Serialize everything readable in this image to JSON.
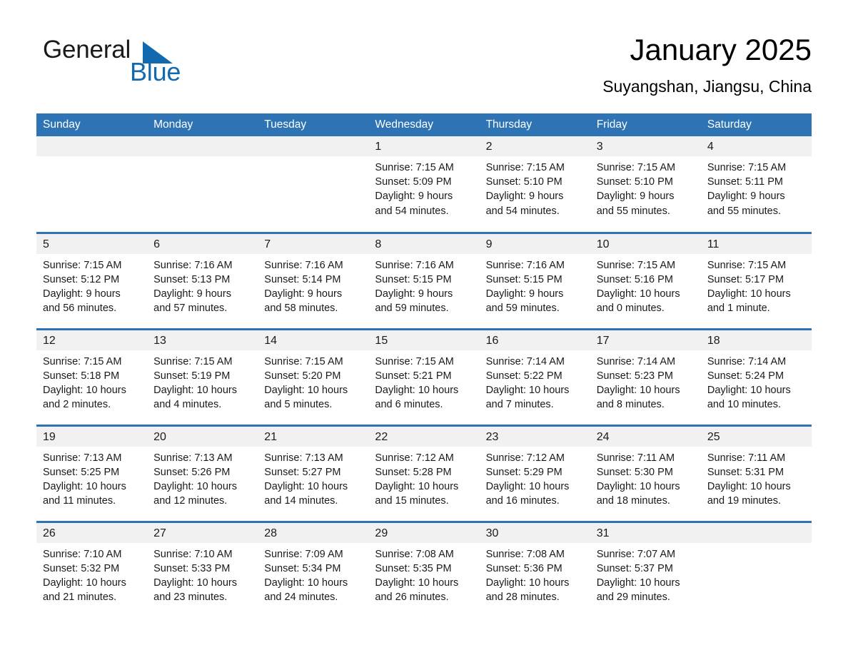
{
  "brand": {
    "name_part1": "General",
    "name_part2": "Blue",
    "accent_color": "#1369b0",
    "triangle_icon": "triangle-icon"
  },
  "header": {
    "month_title": "January 2025",
    "location": "Suyangshan, Jiangsu, China"
  },
  "calendar": {
    "header_color": "#2e74b5",
    "daynum_strip_color": "#f1f1f1",
    "weekday_headers": [
      "Sunday",
      "Monday",
      "Tuesday",
      "Wednesday",
      "Thursday",
      "Friday",
      "Saturday"
    ],
    "weeks": [
      [
        {
          "day": "",
          "sunrise": "",
          "sunset": "",
          "daylight": "",
          "daylight2": ""
        },
        {
          "day": "",
          "sunrise": "",
          "sunset": "",
          "daylight": "",
          "daylight2": ""
        },
        {
          "day": "",
          "sunrise": "",
          "sunset": "",
          "daylight": "",
          "daylight2": ""
        },
        {
          "day": "1",
          "sunrise": "Sunrise: 7:15 AM",
          "sunset": "Sunset: 5:09 PM",
          "daylight": "Daylight: 9 hours",
          "daylight2": "and 54 minutes."
        },
        {
          "day": "2",
          "sunrise": "Sunrise: 7:15 AM",
          "sunset": "Sunset: 5:10 PM",
          "daylight": "Daylight: 9 hours",
          "daylight2": "and 54 minutes."
        },
        {
          "day": "3",
          "sunrise": "Sunrise: 7:15 AM",
          "sunset": "Sunset: 5:10 PM",
          "daylight": "Daylight: 9 hours",
          "daylight2": "and 55 minutes."
        },
        {
          "day": "4",
          "sunrise": "Sunrise: 7:15 AM",
          "sunset": "Sunset: 5:11 PM",
          "daylight": "Daylight: 9 hours",
          "daylight2": "and 55 minutes."
        }
      ],
      [
        {
          "day": "5",
          "sunrise": "Sunrise: 7:15 AM",
          "sunset": "Sunset: 5:12 PM",
          "daylight": "Daylight: 9 hours",
          "daylight2": "and 56 minutes."
        },
        {
          "day": "6",
          "sunrise": "Sunrise: 7:16 AM",
          "sunset": "Sunset: 5:13 PM",
          "daylight": "Daylight: 9 hours",
          "daylight2": "and 57 minutes."
        },
        {
          "day": "7",
          "sunrise": "Sunrise: 7:16 AM",
          "sunset": "Sunset: 5:14 PM",
          "daylight": "Daylight: 9 hours",
          "daylight2": "and 58 minutes."
        },
        {
          "day": "8",
          "sunrise": "Sunrise: 7:16 AM",
          "sunset": "Sunset: 5:15 PM",
          "daylight": "Daylight: 9 hours",
          "daylight2": "and 59 minutes."
        },
        {
          "day": "9",
          "sunrise": "Sunrise: 7:16 AM",
          "sunset": "Sunset: 5:15 PM",
          "daylight": "Daylight: 9 hours",
          "daylight2": "and 59 minutes."
        },
        {
          "day": "10",
          "sunrise": "Sunrise: 7:15 AM",
          "sunset": "Sunset: 5:16 PM",
          "daylight": "Daylight: 10 hours",
          "daylight2": "and 0 minutes."
        },
        {
          "day": "11",
          "sunrise": "Sunrise: 7:15 AM",
          "sunset": "Sunset: 5:17 PM",
          "daylight": "Daylight: 10 hours",
          "daylight2": "and 1 minute."
        }
      ],
      [
        {
          "day": "12",
          "sunrise": "Sunrise: 7:15 AM",
          "sunset": "Sunset: 5:18 PM",
          "daylight": "Daylight: 10 hours",
          "daylight2": "and 2 minutes."
        },
        {
          "day": "13",
          "sunrise": "Sunrise: 7:15 AM",
          "sunset": "Sunset: 5:19 PM",
          "daylight": "Daylight: 10 hours",
          "daylight2": "and 4 minutes."
        },
        {
          "day": "14",
          "sunrise": "Sunrise: 7:15 AM",
          "sunset": "Sunset: 5:20 PM",
          "daylight": "Daylight: 10 hours",
          "daylight2": "and 5 minutes."
        },
        {
          "day": "15",
          "sunrise": "Sunrise: 7:15 AM",
          "sunset": "Sunset: 5:21 PM",
          "daylight": "Daylight: 10 hours",
          "daylight2": "and 6 minutes."
        },
        {
          "day": "16",
          "sunrise": "Sunrise: 7:14 AM",
          "sunset": "Sunset: 5:22 PM",
          "daylight": "Daylight: 10 hours",
          "daylight2": "and 7 minutes."
        },
        {
          "day": "17",
          "sunrise": "Sunrise: 7:14 AM",
          "sunset": "Sunset: 5:23 PM",
          "daylight": "Daylight: 10 hours",
          "daylight2": "and 8 minutes."
        },
        {
          "day": "18",
          "sunrise": "Sunrise: 7:14 AM",
          "sunset": "Sunset: 5:24 PM",
          "daylight": "Daylight: 10 hours",
          "daylight2": "and 10 minutes."
        }
      ],
      [
        {
          "day": "19",
          "sunrise": "Sunrise: 7:13 AM",
          "sunset": "Sunset: 5:25 PM",
          "daylight": "Daylight: 10 hours",
          "daylight2": "and 11 minutes."
        },
        {
          "day": "20",
          "sunrise": "Sunrise: 7:13 AM",
          "sunset": "Sunset: 5:26 PM",
          "daylight": "Daylight: 10 hours",
          "daylight2": "and 12 minutes."
        },
        {
          "day": "21",
          "sunrise": "Sunrise: 7:13 AM",
          "sunset": "Sunset: 5:27 PM",
          "daylight": "Daylight: 10 hours",
          "daylight2": "and 14 minutes."
        },
        {
          "day": "22",
          "sunrise": "Sunrise: 7:12 AM",
          "sunset": "Sunset: 5:28 PM",
          "daylight": "Daylight: 10 hours",
          "daylight2": "and 15 minutes."
        },
        {
          "day": "23",
          "sunrise": "Sunrise: 7:12 AM",
          "sunset": "Sunset: 5:29 PM",
          "daylight": "Daylight: 10 hours",
          "daylight2": "and 16 minutes."
        },
        {
          "day": "24",
          "sunrise": "Sunrise: 7:11 AM",
          "sunset": "Sunset: 5:30 PM",
          "daylight": "Daylight: 10 hours",
          "daylight2": "and 18 minutes."
        },
        {
          "day": "25",
          "sunrise": "Sunrise: 7:11 AM",
          "sunset": "Sunset: 5:31 PM",
          "daylight": "Daylight: 10 hours",
          "daylight2": "and 19 minutes."
        }
      ],
      [
        {
          "day": "26",
          "sunrise": "Sunrise: 7:10 AM",
          "sunset": "Sunset: 5:32 PM",
          "daylight": "Daylight: 10 hours",
          "daylight2": "and 21 minutes."
        },
        {
          "day": "27",
          "sunrise": "Sunrise: 7:10 AM",
          "sunset": "Sunset: 5:33 PM",
          "daylight": "Daylight: 10 hours",
          "daylight2": "and 23 minutes."
        },
        {
          "day": "28",
          "sunrise": "Sunrise: 7:09 AM",
          "sunset": "Sunset: 5:34 PM",
          "daylight": "Daylight: 10 hours",
          "daylight2": "and 24 minutes."
        },
        {
          "day": "29",
          "sunrise": "Sunrise: 7:08 AM",
          "sunset": "Sunset: 5:35 PM",
          "daylight": "Daylight: 10 hours",
          "daylight2": "and 26 minutes."
        },
        {
          "day": "30",
          "sunrise": "Sunrise: 7:08 AM",
          "sunset": "Sunset: 5:36 PM",
          "daylight": "Daylight: 10 hours",
          "daylight2": "and 28 minutes."
        },
        {
          "day": "31",
          "sunrise": "Sunrise: 7:07 AM",
          "sunset": "Sunset: 5:37 PM",
          "daylight": "Daylight: 10 hours",
          "daylight2": "and 29 minutes."
        },
        {
          "day": "",
          "sunrise": "",
          "sunset": "",
          "daylight": "",
          "daylight2": ""
        }
      ]
    ]
  }
}
